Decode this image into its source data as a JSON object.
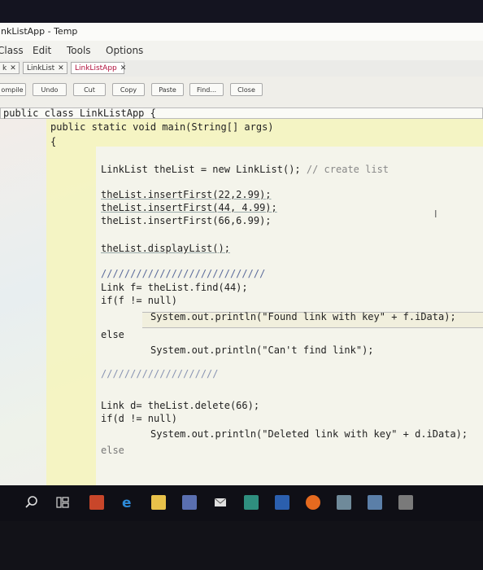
{
  "window": {
    "title": "inkListApp - Temp"
  },
  "menu": [
    "Class",
    "Edit",
    "Tools",
    "Options"
  ],
  "tabs": [
    {
      "label": "k"
    },
    {
      "label": "LinkList"
    },
    {
      "label": "LinkListApp"
    }
  ],
  "toolbar": {
    "compile": "ompile",
    "undo": "Undo",
    "cut": "Cut",
    "copy": "Copy",
    "paste": "Paste",
    "find": "Find...",
    "close": "Close"
  },
  "code": {
    "line1": "public class LinkListApp {",
    "line2": "public static void main(String[] args)",
    "line3": "{",
    "line4a": "LinkList theList = new LinkList(); ",
    "line4b": "// create list",
    "line5": "theList.insertFirst(22,2.99);",
    "line6": "theList.insertFirst(44, 4.99);",
    "line7": "theList.insertFirst(66,6.99);",
    "line8": "theList.displayList();",
    "line9": "////////////////////////////",
    "line10": "Link f= theList.find(44);",
    "line11": "if(f != null)",
    "line12": "System.out.println(\"Found link with key\" + f.iData);",
    "line13": "else",
    "line14": "System.out.println(\"Can't find link\");",
    "line15": "////////////////////",
    "line16": "Link d= theList.delete(66);",
    "line17": "if(d != null)",
    "line18": "System.out.println(\"Deleted link with key\" + d.iData);",
    "line19": "else"
  },
  "taskbar": {
    "icons": [
      "search-icon",
      "task-view-icon",
      "powerpoint-icon",
      "edge-icon",
      "explorer-icon",
      "store-icon",
      "mail-icon",
      "publisher-icon",
      "word-icon",
      "firefox-icon",
      "app-icon",
      "app-icon-2",
      "app-icon-3"
    ]
  }
}
